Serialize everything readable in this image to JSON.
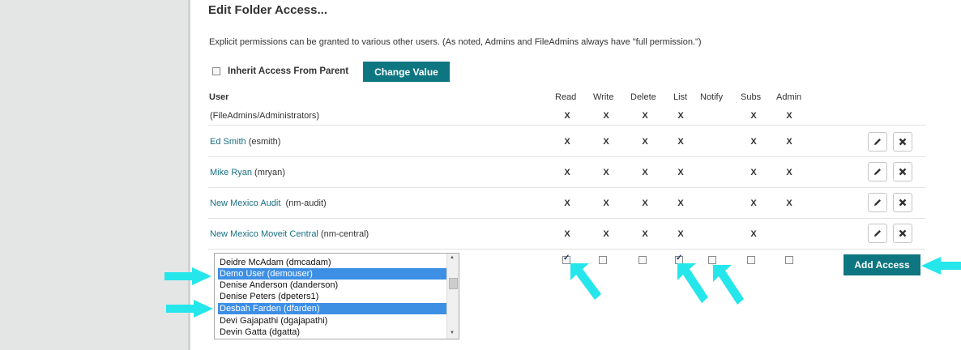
{
  "page": {
    "title": "Edit Folder Access...",
    "description": "Explicit permissions can be granted to various other users. (As noted, Admins and FileAdmins always have \"full permission.\")"
  },
  "inherit": {
    "label": "Inherit Access From Parent",
    "checked": false
  },
  "change_button": "Change Value",
  "columns": [
    "User",
    "Read",
    "Write",
    "Delete",
    "List",
    "Notify",
    "Subs",
    "Admin"
  ],
  "rows": [
    {
      "name": "(FileAdmins/Administrators)",
      "link": "",
      "username": "",
      "read": "X",
      "write": "X",
      "delete": "X",
      "list": "X",
      "notify": "",
      "subs": "X",
      "admin": "X"
    },
    {
      "name": "",
      "link": "Ed Smith",
      "username": " (esmith)",
      "read": "X",
      "write": "X",
      "delete": "X",
      "list": "X",
      "notify": "",
      "subs": "X",
      "admin": "X"
    },
    {
      "name": "",
      "link": "Mike Ryan",
      "username": " (mryan)",
      "read": "X",
      "write": "X",
      "delete": "X",
      "list": "X",
      "notify": "",
      "subs": "X",
      "admin": "X"
    },
    {
      "name": "",
      "link": "New Mexico Audit",
      "username": "  (nm-audit)",
      "read": "X",
      "write": "X",
      "delete": "X",
      "list": "X",
      "notify": "",
      "subs": "X",
      "admin": "X"
    },
    {
      "name": "",
      "link": "New Mexico Moveit Central",
      "username": " (nm-central)",
      "read": "X",
      "write": "X",
      "delete": "X",
      "list": "X",
      "notify": "",
      "subs": "X",
      "admin": ""
    }
  ],
  "user_list": [
    {
      "label": "Deidre McAdam (dmcadam)",
      "selected": false
    },
    {
      "label": "Demo User (demouser)",
      "selected": true
    },
    {
      "label": "Denise Anderson (danderson)",
      "selected": false
    },
    {
      "label": "Denise Peters (dpeters1)",
      "selected": false
    },
    {
      "label": "Desbah Farden (dfarden)",
      "selected": true
    },
    {
      "label": "Devi Gajapathi (dgajapathi)",
      "selected": false
    },
    {
      "label": "Devin Gatta  (dgatta)",
      "selected": false
    }
  ],
  "new_permissions": {
    "read": true,
    "write": false,
    "delete": false,
    "list": true,
    "notify": false,
    "subs": false,
    "admin": false
  },
  "add_button": "Add Access",
  "colors": {
    "accent": "#0e7680",
    "link": "#1a6f82",
    "selection": "#3d8fe4",
    "annotation_arrow": "#25e6ea"
  },
  "icons": [
    "pencil-icon",
    "close-icon",
    "scroll-up-icon",
    "scroll-down-icon",
    "annotation-arrow-icon"
  ]
}
